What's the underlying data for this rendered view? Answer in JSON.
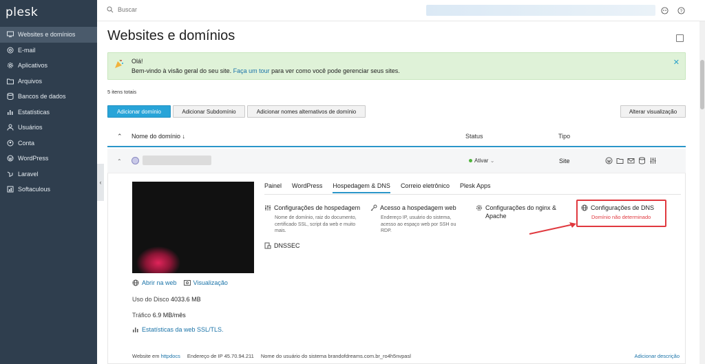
{
  "app": {
    "logo": "plesk"
  },
  "sidebar": {
    "items": [
      {
        "label": "Websites e domínios",
        "icon": "monitor-icon",
        "active": true
      },
      {
        "label": "E-mail",
        "icon": "mail-icon"
      },
      {
        "label": "Aplicativos",
        "icon": "gear-icon"
      },
      {
        "label": "Arquivos",
        "icon": "folder-icon"
      },
      {
        "label": "Bancos de dados",
        "icon": "database-icon"
      },
      {
        "label": "Estatísticas",
        "icon": "bar-chart-icon"
      },
      {
        "label": "Usuários",
        "icon": "user-icon"
      },
      {
        "label": "Conta",
        "icon": "account-icon"
      },
      {
        "label": "WordPress",
        "icon": "wordpress-icon"
      },
      {
        "label": "Laravel",
        "icon": "laravel-icon"
      },
      {
        "label": "Softaculous",
        "icon": "softaculous-icon"
      }
    ],
    "collapse_glyph": "‹"
  },
  "header": {
    "search_placeholder": "Buscar"
  },
  "page": {
    "title": "Websites e domínios"
  },
  "banner": {
    "title": "Olá!",
    "text_before": "Bem-vindo à visão geral do seu site. ",
    "link": "Faça um tour",
    "text_after": " para ver como você pode gerenciar seus sites.",
    "close_glyph": "✕"
  },
  "list": {
    "items_total": "5 itens totais",
    "buttons": {
      "add_domain": "Adicionar domínio",
      "add_subdomain": "Adicionar Subdomínio",
      "add_alias": "Adicionar nomes alternativos de domínio",
      "change_view": "Alterar visualização"
    },
    "columns": {
      "domain": "Nome do domínio ↓",
      "status": "Status",
      "type": "Tipo"
    },
    "row": {
      "status": "Ativar",
      "type": "Site"
    }
  },
  "panel": {
    "links": {
      "open_web": "Abrir na web",
      "preview": "Visualização"
    },
    "disk_label": "Uso do Disco",
    "disk_value": "4033.6 MB",
    "traffic_label": "Tráfico",
    "traffic_value": "6.9 MB/mês",
    "ssl_link": "Estatísticas da web SSL/TLS.",
    "tabs": [
      "Painel",
      "WordPress",
      "Hospedagem & DNS",
      "Correio eletrônico",
      "Plesk Apps"
    ],
    "active_tab": "Hospedagem & DNS",
    "tools": {
      "hosting": {
        "title": "Configurações de hospedagem",
        "desc": "Nome de domínio, raiz do documento, certificado SSL, script da web e muito mais."
      },
      "access": {
        "title": "Acesso a hospedagem web",
        "desc": "Endereço IP, usuário do sistema, acesso ao espaço web por SSH ou RDP."
      },
      "nginx": {
        "title": "Configurações do nginx & Apache"
      },
      "dns": {
        "title": "Configurações de DNS",
        "warning": "Domínio não determinado"
      },
      "dnssec": {
        "title": "DNSSEC"
      }
    },
    "footer": {
      "website_label": "Website em",
      "website_link": "httpdocs",
      "ip_label": "Endereço de IP",
      "ip_value": "45.70.94.211",
      "sysuser_label": "Nome do usuário do sistema",
      "sysuser_value": "brandofdreams.com.br_ro4h5nvpasl",
      "add_description": "Adicionar descrição"
    }
  },
  "colors": {
    "sidebar_bg": "#2f3e4e",
    "accent": "#28a4d8",
    "warning": "#e0383e",
    "banner_bg": "#dff2d8"
  }
}
